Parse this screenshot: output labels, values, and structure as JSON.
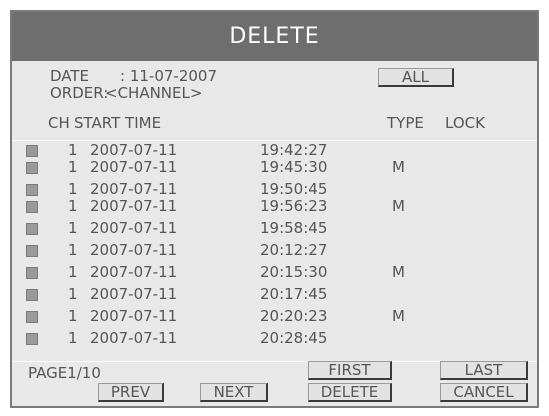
{
  "title": "DELETE",
  "date_label": "DATE",
  "date_value": ": 11-07-2007",
  "order_label": "ORDER:",
  "order_value": "<CHANNEL>",
  "all_button": "ALL",
  "columns": {
    "ch": "CH",
    "start_time": "START TIME",
    "type": "TYPE",
    "lock": "LOCK"
  },
  "rows": [
    {
      "ch": "1",
      "date": "2007-07-11",
      "time": "19:42:27",
      "type": ""
    },
    {
      "ch": "1",
      "date": "2007-07-11",
      "time": "19:45:30",
      "type": "M"
    },
    {
      "ch": "1",
      "date": "2007-07-11",
      "time": "19:50:45",
      "type": ""
    },
    {
      "ch": "1",
      "date": "2007-07-11",
      "time": "19:56:23",
      "type": "M"
    },
    {
      "ch": "1",
      "date": "2007-07-11",
      "time": "19:58:45",
      "type": ""
    },
    {
      "ch": "1",
      "date": "2007-07-11",
      "time": "20:12:27",
      "type": ""
    },
    {
      "ch": "1",
      "date": "2007-07-11",
      "time": "20:15:30",
      "type": "M"
    },
    {
      "ch": "1",
      "date": "2007-07-11",
      "time": "20:17:45",
      "type": ""
    },
    {
      "ch": "1",
      "date": "2007-07-11",
      "time": "20:20:23",
      "type": "M"
    },
    {
      "ch": "1",
      "date": "2007-07-11",
      "time": "20:28:45",
      "type": ""
    }
  ],
  "page_indicator": "PAGE1/10",
  "buttons": {
    "first": "FIRST",
    "last": "LAST",
    "prev": "PREV",
    "next": "NEXT",
    "delete": "DELETE",
    "cancel": "CANCEL"
  },
  "colors": {
    "title_bar": "#6e6e6e",
    "panel": "#e8e8e8",
    "checkbox": "#9a9a9a"
  }
}
